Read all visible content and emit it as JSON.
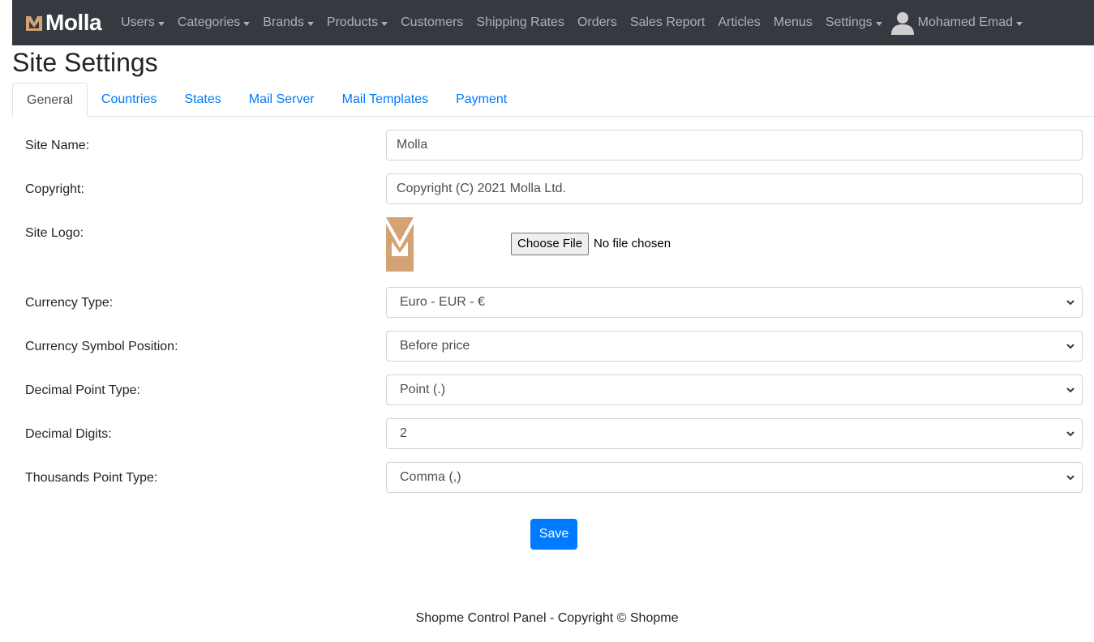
{
  "navbar": {
    "brand": "Molla",
    "items": [
      {
        "label": "Users",
        "dropdown": true
      },
      {
        "label": "Categories",
        "dropdown": true
      },
      {
        "label": "Brands",
        "dropdown": true
      },
      {
        "label": "Products",
        "dropdown": true
      },
      {
        "label": "Customers",
        "dropdown": false
      },
      {
        "label": "Shipping Rates",
        "dropdown": false
      },
      {
        "label": "Orders",
        "dropdown": false
      },
      {
        "label": "Sales Report",
        "dropdown": false
      },
      {
        "label": "Articles",
        "dropdown": false
      },
      {
        "label": "Menus",
        "dropdown": false
      },
      {
        "label": "Settings",
        "dropdown": true
      }
    ],
    "user_name": "Mohamed Emad"
  },
  "page": {
    "title": "Site Settings"
  },
  "tabs": [
    "General",
    "Countries",
    "States",
    "Mail Server",
    "Mail Templates",
    "Payment"
  ],
  "form": {
    "site_name_label": "Site Name:",
    "site_name_value": "Molla",
    "copyright_label": "Copyright:",
    "copyright_value": "Copyright (C) 2021 Molla Ltd.",
    "site_logo_label": "Site Logo:",
    "choose_file_label": "Choose File",
    "file_status": "No file chosen",
    "currency_type_label": "Currency Type:",
    "currency_type_value": "Euro - EUR - €",
    "symbol_position_label": "Currency Symbol Position:",
    "symbol_position_value": "Before price",
    "decimal_point_label": "Decimal Point Type:",
    "decimal_point_value": "Point (.)",
    "decimal_digits_label": "Decimal Digits:",
    "decimal_digits_value": "2",
    "thousands_point_label": "Thousands Point Type:",
    "thousands_point_value": "Comma (,)",
    "save_label": "Save"
  },
  "footer": {
    "text": "Shopme Control Panel - Copyright © Shopme"
  },
  "colors": {
    "navbar_bg": "#343a40",
    "primary": "#007bff",
    "logo_accent": "#d4a373"
  },
  "icons": {
    "brand_logo": "molla-m-logo-icon",
    "user": "user-avatar-icon",
    "dropdown": "caret-down-icon",
    "select": "chevron-down-icon"
  }
}
